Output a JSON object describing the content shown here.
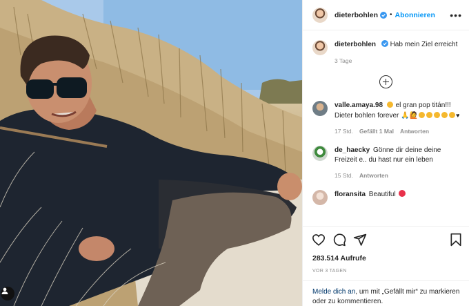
{
  "post": {
    "username": "dieterbohlen",
    "follow_label": "Abonnieren",
    "separator": "•",
    "more_label": "•••"
  },
  "caption": {
    "username": "dieterbohlen",
    "text": "Hab mein Ziel erreicht",
    "time": "3 Tage"
  },
  "comments": [
    {
      "username": "valle.amaya.98",
      "text_before": "el gran pop titán!!! Dieter bohlen forever",
      "time": "17 Std.",
      "likes": "Gefällt 1 Mal",
      "reply_label": "Antworten"
    },
    {
      "username": "de_haecky",
      "text": "Gönne dir deine deine Freizeit e.. du hast nur ein leben",
      "time": "15 Std.",
      "reply_label": "Antworten"
    },
    {
      "username": "floransita",
      "text": "Beautiful"
    }
  ],
  "actions": {
    "like_icon": "heart-icon",
    "comment_icon": "comment-icon",
    "share_icon": "share-icon",
    "save_icon": "bookmark-icon"
  },
  "stats": {
    "views": "283.514 Aufrufe",
    "date": "VOR 3 TAGEN"
  },
  "login_prompt": {
    "link": "Melde dich an",
    "text": ", um mit „Gefällt mir“ zu markieren oder zu kommentieren."
  },
  "colors": {
    "accent": "#0095f6",
    "text": "#262626",
    "muted": "#8e8e8e",
    "link": "#00376b"
  }
}
